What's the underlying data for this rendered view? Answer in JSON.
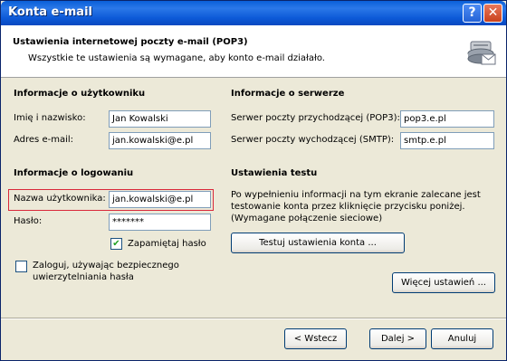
{
  "window": {
    "title": "Konta e-mail",
    "help_glyph": "?",
    "close_glyph": "✕"
  },
  "header": {
    "title": "Ustawienia internetowej poczty e-mail (POP3)",
    "subtitle": "Wszystkie te ustawienia są wymagane, aby konto e-mail działało.",
    "icon": "mail-server-icon"
  },
  "user_info": {
    "heading": "Informacje o użytkowniku",
    "name_label": "Imię i nazwisko:",
    "name_value": "Jan Kowalski",
    "email_label": "Adres e-mail:",
    "email_value": "jan.kowalski@e.pl"
  },
  "server_info": {
    "heading": "Informacje o serwerze",
    "incoming_label": "Serwer poczty przychodzącej (POP3):",
    "incoming_value": "pop3.e.pl",
    "outgoing_label": "Serwer poczty wychodzącej (SMTP):",
    "outgoing_value": "smtp.e.pl"
  },
  "logon_info": {
    "heading": "Informacje o logowaniu",
    "username_label": "Nazwa użytkownika:",
    "username_value": "jan.kowalski@e.pl",
    "password_label": "Hasło:",
    "password_value": "*******",
    "remember_label": "Zapamiętaj hasło",
    "remember_checked": true,
    "spa_label_line1": "Zaloguj, używając bezpiecznego",
    "spa_label_line2": "uwierzytelniania hasła",
    "spa_checked": false
  },
  "test_settings": {
    "heading": "Ustawienia testu",
    "desc_line1": "Po wypełnieniu informacji na tym ekranie zalecane jest",
    "desc_line2": "testowanie konta przez kliknięcie przycisku poniżej.",
    "desc_line3": "(Wymagane połączenie sieciowe)",
    "test_button": "Testuj ustawienia konta ..."
  },
  "buttons": {
    "more_settings": "Więcej ustawień ...",
    "back": "< Wstecz",
    "next": "Dalej >",
    "cancel": "Anuluj"
  },
  "colors": {
    "title_bar": "#0a5fd8",
    "dialog_bg": "#ece9d8",
    "highlight_border": "#d9283a"
  }
}
